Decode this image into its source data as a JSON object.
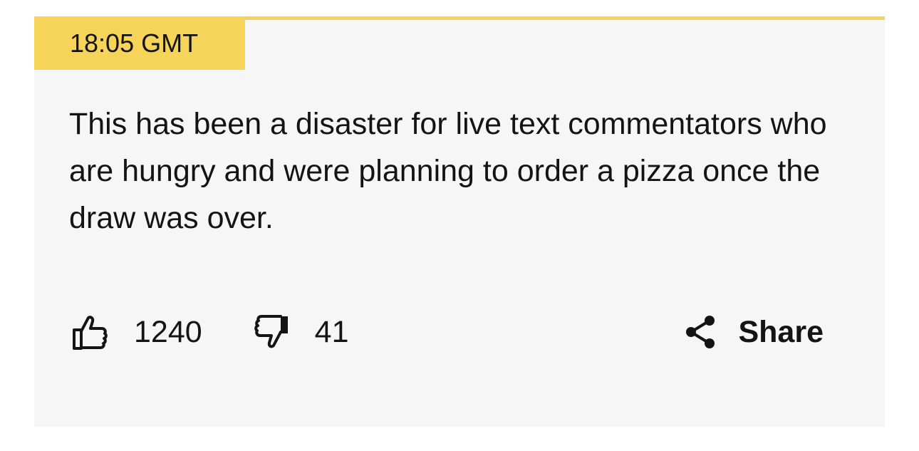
{
  "entry": {
    "timestamp": "18:05 GMT",
    "body": "This has been a disaster for live text commentators who are hungry and were planning to order a pizza once the draw was over."
  },
  "reactions": {
    "like_count": "1240",
    "dislike_count": "41",
    "like_icon": "thumbs-up-icon",
    "dislike_icon": "thumbs-down-icon"
  },
  "share": {
    "label": "Share",
    "icon": "share-icon"
  },
  "colors": {
    "accent": "#f6d45a",
    "card_background": "#f6f6f6",
    "text": "#141414"
  }
}
